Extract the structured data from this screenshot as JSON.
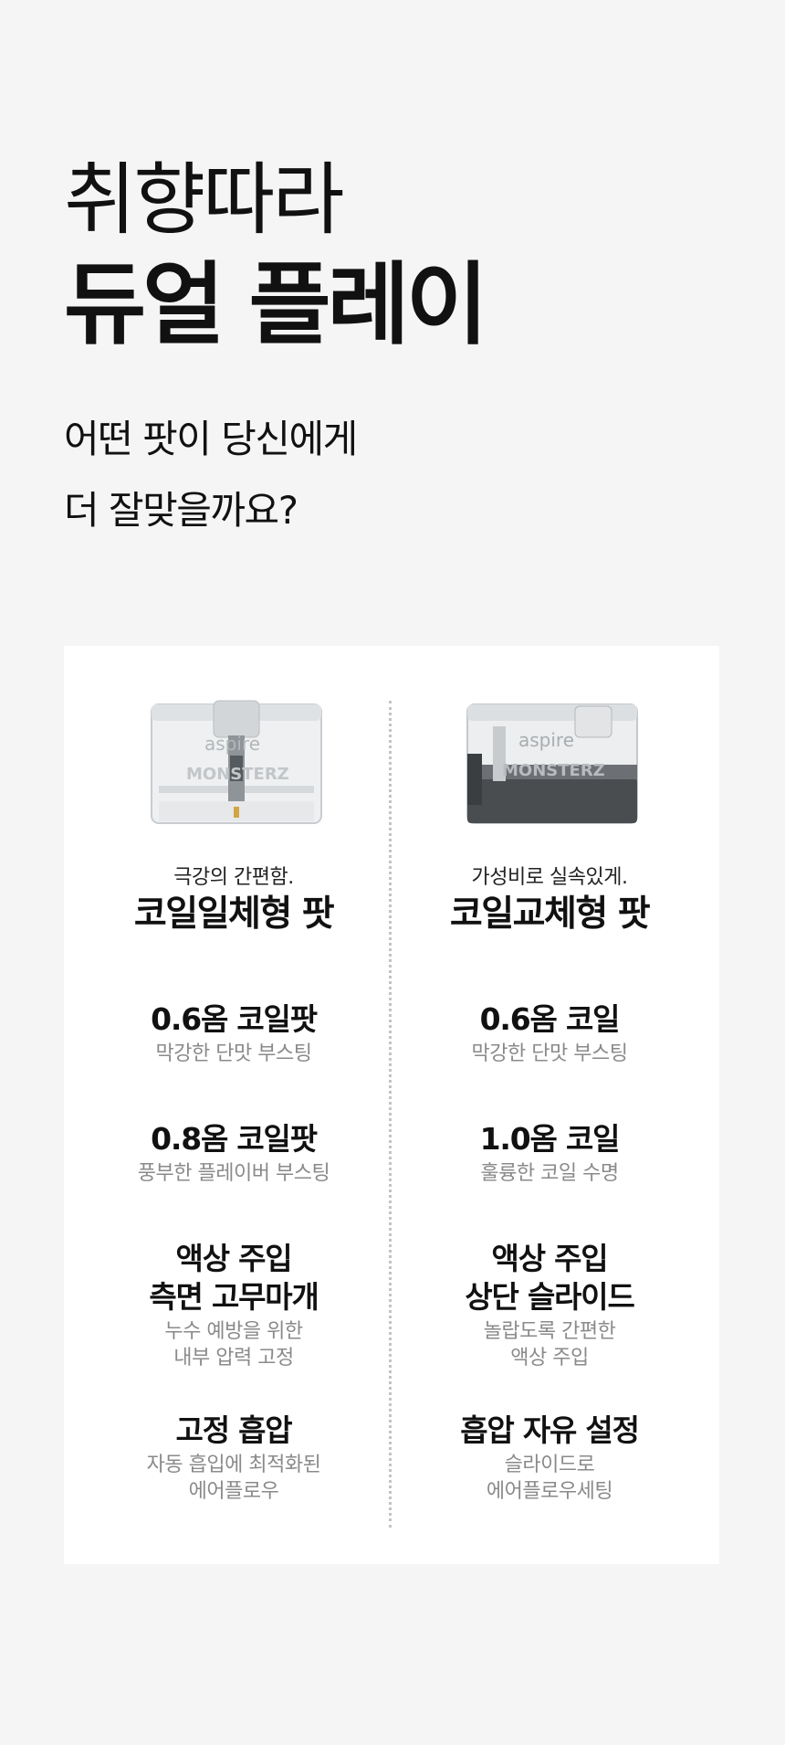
{
  "hero": {
    "line1": "취향따라",
    "line2": "듀얼 플레이",
    "sub1": "어떤 팟이 당신에게",
    "sub2": "더 잘맞을까요?"
  },
  "left": {
    "pod_brand": "aspire",
    "pod_collab": "MONSTERZ",
    "tagline": "극강의 간편함.",
    "type": "코일일체형 팟",
    "features": [
      {
        "title": "0.6옴 코일팟",
        "desc1": "막강한 단맛 부스팅"
      },
      {
        "title": "0.8옴 코일팟",
        "desc1": "풍부한 플레이버 부스팅"
      },
      {
        "title1": "액상 주입",
        "title2": "측면 고무마개",
        "desc1": "누수 예방을 위한",
        "desc2": "내부 압력 고정"
      },
      {
        "title": "고정 흡압",
        "desc1": "자동 흡입에 최적화된",
        "desc2": "에어플로우"
      }
    ]
  },
  "right": {
    "pod_brand": "aspire",
    "pod_collab": "MONSTERZ",
    "tagline": "가성비로 실속있게.",
    "type": "코일교체형 팟",
    "features": [
      {
        "title": "0.6옴 코일",
        "desc1": "막강한 단맛 부스팅"
      },
      {
        "title": "1.0옴 코일",
        "desc1": "훌륭한 코일 수명"
      },
      {
        "title1": "액상 주입",
        "title2": "상단 슬라이드",
        "desc1": "놀랍도록 간편한",
        "desc2": "액상 주입"
      },
      {
        "title": "흡압 자유 설정",
        "desc1": "슬라이드로",
        "desc2": "에어플로우세팅"
      }
    ]
  },
  "colors": {
    "background": "#f5f5f5",
    "card": "#ffffff",
    "muted": "#8a8a8a",
    "divider": "#c3c3c3"
  }
}
